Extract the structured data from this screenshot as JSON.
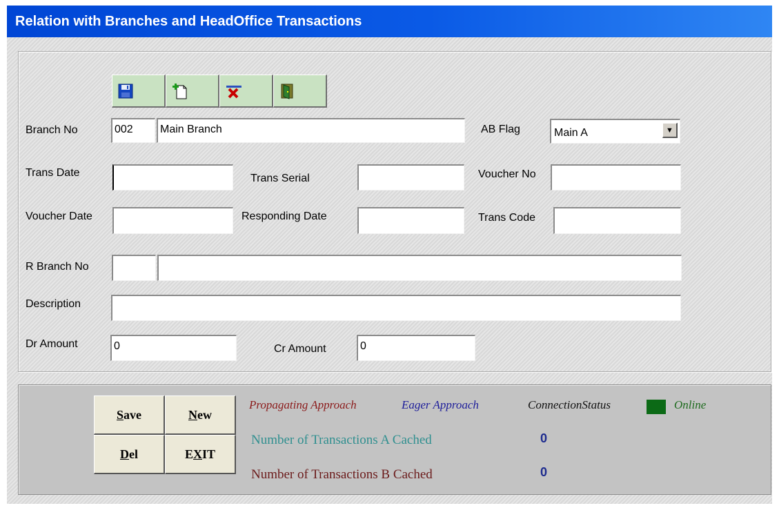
{
  "window": {
    "title": "Relation with Branches and HeadOffice Transactions"
  },
  "toolbar": {
    "icons": [
      "save-icon",
      "new-record-icon",
      "delete-icon",
      "exit-door-icon"
    ]
  },
  "form": {
    "branch_no": {
      "label": "Branch No",
      "code": "002",
      "name": "Main Branch"
    },
    "ab_flag": {
      "label": "AB Flag",
      "value": "Main A"
    },
    "trans_date": {
      "label": "Trans Date",
      "value": ""
    },
    "trans_serial": {
      "label": "Trans Serial",
      "value": ""
    },
    "voucher_no": {
      "label": "Voucher No",
      "value": ""
    },
    "voucher_date": {
      "label": "Voucher Date",
      "value": ""
    },
    "responding_date": {
      "label": "Responding Date",
      "value": ""
    },
    "trans_code": {
      "label": "Trans Code",
      "value": ""
    },
    "r_branch_no": {
      "label": "R Branch No",
      "code": "",
      "name": ""
    },
    "description": {
      "label": "Description",
      "value": ""
    },
    "dr_amount": {
      "label": "Dr Amount",
      "value": "0"
    },
    "cr_amount": {
      "label": "Cr Amount",
      "value": "0"
    }
  },
  "commands": {
    "save": {
      "hotkey": "S",
      "rest": "ave"
    },
    "new": {
      "hotkey": "N",
      "rest": "ew"
    },
    "del": {
      "hotkey": "D",
      "rest": "el"
    },
    "exit": {
      "pre": "E",
      "hotkey": "X",
      "post": "IT"
    }
  },
  "status": {
    "propagating": "Propagating Approach",
    "eager": "Eager Approach",
    "connection_label": "ConnectionStatus",
    "connection_value": "Online",
    "connection_color": "#0c6a16",
    "cached_a_label": "Number of Transactions A Cached",
    "cached_a_value": "0",
    "cached_b_label": "Number of Transactions B Cached",
    "cached_b_value": "0"
  },
  "colors": {
    "propagating": "#8b1a1a",
    "eager": "#1d1d9a",
    "cached_a": "#2f8f8f",
    "cached_b": "#6b1a1a",
    "online": "#1e6b1e"
  }
}
